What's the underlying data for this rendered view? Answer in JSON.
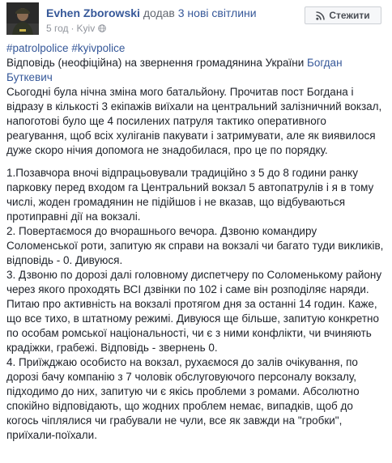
{
  "post": {
    "author": "Evhen Zborowski",
    "action_prefix": "додав",
    "action_count": "3 нові світлини",
    "time": "5 год",
    "location": "Kyiv",
    "follow_label": "Стежити",
    "hashtags": [
      "#patrolpolice",
      "#kyivpolice"
    ],
    "intro_prefix": "Відповідь (неофіційна) на звернення громадянина України",
    "intro_person": "Богдан Буткевич",
    "paragraphs": [
      "Сьогодні була нічна зміна мого батальйону. Прочитав пост Богдана і відразу в кількості 3 екіпажів виїхали на центральний залізничний вокзал, напоготові було ще 4 посилених патруля тактико оперативного реагування, щоб всіх хуліганів пакувати і затримувати, але як виявилося дуже скоро нічия допомога не знадобилася, про це по порядку.",
      "1.Позавчора вночі відпрацьовували традиційно з 5 до 8 години ранку парковку перед входом га Центральний вокзал 5 автопатрулів і я в тому числі, жоден громадянин не підійшов і не вказав, що відбуваються протиправні дії на вокзалі.",
      "2. Повертаємося до вчорашнього вечора. Дзвоню командиру Соломенської роти, запитую як справи на вокзалі чи багато туди викликів, відповідь - 0. Дивуюся.",
      "3. Дзвоню по дорозі далі головному диспетчеру по Соломенькому району через якого проходять ВСІ дзвінки по 102 і саме він розподіляє наряди. Питаю про активність на вокзалі протягом дня за останні 14 годин. Каже, що все тихо, в штатному режимі. Дивуюся ще більше, запитую конкретно по особам ромської національності, чи є з ними конфлікти, чи вчиняють крадіжки, грабежі. Відповідь - звернень 0.",
      "4. Приїжджаю особисто на вокзал, рухаємося до залів очікування, по дорозі бачу компанію з 7 чоловік обслуговуючого персоналу вокзалу, підходимо до них, запитую чи є якісь проблеми з ромами. Абсолютно спокійно відповідають, що жодних проблем немає, випадків, щоб до когось чіплялися чи грабували не чули, все як завжди на \"гробки\", приїхали-поїхали."
    ]
  }
}
